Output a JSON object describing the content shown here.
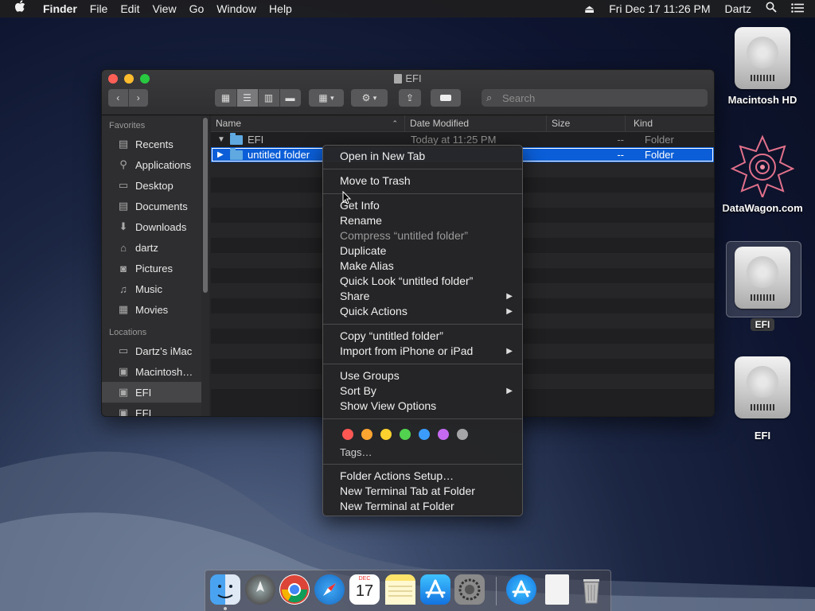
{
  "menubar": {
    "apple": "",
    "app": "Finder",
    "menus": [
      "File",
      "Edit",
      "View",
      "Go",
      "Window",
      "Help"
    ],
    "eject": "⏏",
    "datetime": "Fri Dec 17  11:26 PM",
    "user": "Dartz"
  },
  "desktop": {
    "icons": [
      {
        "label": "Macintosh HD",
        "icon": "hard-drive-icon"
      },
      {
        "label": "DataWagon.com",
        "icon": "datawagon-logo-icon"
      },
      {
        "label": "EFI",
        "icon": "hard-drive-icon",
        "selected": true
      },
      {
        "label": "EFI",
        "icon": "hard-drive-icon"
      }
    ]
  },
  "finder": {
    "title": "EFI",
    "search_placeholder": "Search",
    "sidebar": {
      "favorites_title": "Favorites",
      "favorites": [
        {
          "label": "Recents",
          "icon": "recents-icon"
        },
        {
          "label": "Applications",
          "icon": "applications-icon"
        },
        {
          "label": "Desktop",
          "icon": "desktop-icon"
        },
        {
          "label": "Documents",
          "icon": "documents-icon"
        },
        {
          "label": "Downloads",
          "icon": "downloads-icon"
        },
        {
          "label": "dartz",
          "icon": "home-icon"
        },
        {
          "label": "Pictures",
          "icon": "pictures-icon"
        },
        {
          "label": "Music",
          "icon": "music-icon"
        },
        {
          "label": "Movies",
          "icon": "movies-icon"
        }
      ],
      "locations_title": "Locations",
      "locations": [
        {
          "label": "Dartz’s iMac",
          "icon": "computer-icon"
        },
        {
          "label": "Macintosh…",
          "icon": "disk-icon"
        },
        {
          "label": "EFI",
          "icon": "disk-icon",
          "selected": true
        },
        {
          "label": "EFI",
          "icon": "disk-icon"
        }
      ]
    },
    "columns": [
      "Name",
      "Date Modified",
      "Size",
      "Kind"
    ],
    "rows": [
      {
        "name": "EFI",
        "date": "Today at 11:25 PM",
        "size": "--",
        "kind": "Folder",
        "expanded": true
      },
      {
        "name": "untitled folder",
        "date": "",
        "size": "--",
        "kind": "Folder",
        "selected": true
      }
    ]
  },
  "context_menu": {
    "open_new_tab": "Open in New Tab",
    "move_to_trash": "Move to Trash",
    "get_info": "Get Info",
    "rename": "Rename",
    "compress": "Compress “untitled folder”",
    "duplicate": "Duplicate",
    "make_alias": "Make Alias",
    "quick_look": "Quick Look “untitled folder”",
    "share": "Share",
    "quick_actions": "Quick Actions",
    "copy": "Copy “untitled folder”",
    "import_iphone": "Import from iPhone or iPad",
    "use_groups": "Use Groups",
    "sort_by": "Sort By",
    "show_view_options": "Show View Options",
    "tag_colors": [
      "#fc5753",
      "#fda531",
      "#fdd22e",
      "#52d34f",
      "#3b9cfd",
      "#c56af0",
      "#a5a5a7"
    ],
    "tags": "Tags…",
    "folder_actions": "Folder Actions Setup…",
    "new_terminal_tab": "New Terminal Tab at Folder",
    "new_terminal": "New Terminal at Folder"
  },
  "dock": {
    "apps": [
      "finder-icon",
      "launchpad-icon",
      "chrome-icon",
      "safari-icon",
      "calendar-icon",
      "notes-icon",
      "app-store-icon",
      "system-preferences-icon",
      "app-store-download-icon",
      "document-icon",
      "trash-icon"
    ],
    "calendar_month": "DEC",
    "calendar_day": "17"
  }
}
